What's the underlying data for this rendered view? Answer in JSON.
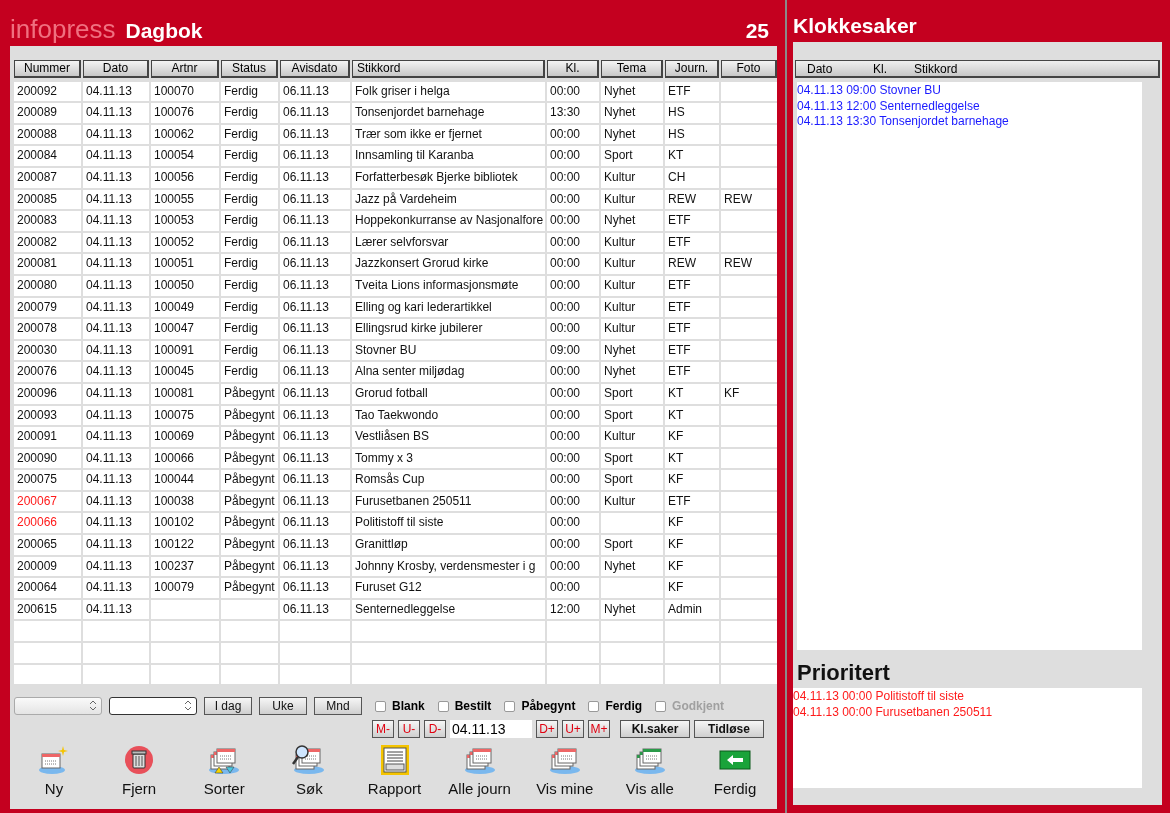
{
  "dagbok": {
    "brand": "infopress",
    "title": "Dagbok",
    "count": "25",
    "columns": [
      "Nummer",
      "Dato",
      "Artnr",
      "Status",
      "Avisdato",
      "Stikkord",
      "Kl.",
      "Tema",
      "Journ.",
      "Foto"
    ],
    "rows": [
      {
        "cells": [
          "200092",
          "04.11.13",
          "100070",
          "Ferdig",
          "06.11.13",
          "Folk griser i helga",
          "00:00",
          "Nyhet",
          "ETF",
          ""
        ],
        "flagged": false
      },
      {
        "cells": [
          "200089",
          "04.11.13",
          "100076",
          "Ferdig",
          "06.11.13",
          "Tonsenjordet barnehage",
          "13:30",
          "Nyhet",
          "HS",
          ""
        ],
        "flagged": false
      },
      {
        "cells": [
          "200088",
          "04.11.13",
          "100062",
          "Ferdig",
          "06.11.13",
          "Trær som ikke er fjernet",
          "00:00",
          "Nyhet",
          "HS",
          ""
        ],
        "flagged": false
      },
      {
        "cells": [
          "200084",
          "04.11.13",
          "100054",
          "Ferdig",
          "06.11.13",
          "Innsamling til Karanba",
          "00:00",
          "Sport",
          "KT",
          ""
        ],
        "flagged": false
      },
      {
        "cells": [
          "200087",
          "04.11.13",
          "100056",
          "Ferdig",
          "06.11.13",
          "Forfatterbesøk Bjerke bibliotek",
          "00:00",
          "Kultur",
          "CH",
          ""
        ],
        "flagged": false
      },
      {
        "cells": [
          "200085",
          "04.11.13",
          "100055",
          "Ferdig",
          "06.11.13",
          "Jazz på Vardeheim",
          "00:00",
          "Kultur",
          "REW",
          "REW"
        ],
        "flagged": false
      },
      {
        "cells": [
          "200083",
          "04.11.13",
          "100053",
          "Ferdig",
          "06.11.13",
          "Hoppekonkurranse av Nasjonalfore",
          "00:00",
          "Nyhet",
          "ETF",
          ""
        ],
        "flagged": false
      },
      {
        "cells": [
          "200082",
          "04.11.13",
          "100052",
          "Ferdig",
          "06.11.13",
          "Lærer selvforsvar",
          "00:00",
          "Kultur",
          "ETF",
          ""
        ],
        "flagged": false
      },
      {
        "cells": [
          "200081",
          "04.11.13",
          "100051",
          "Ferdig",
          "06.11.13",
          "Jazzkonsert Grorud kirke",
          "00:00",
          "Kultur",
          "REW",
          "REW"
        ],
        "flagged": false
      },
      {
        "cells": [
          "200080",
          "04.11.13",
          "100050",
          "Ferdig",
          "06.11.13",
          "Tveita Lions informasjonsmøte",
          "00:00",
          "Kultur",
          "ETF",
          ""
        ],
        "flagged": false
      },
      {
        "cells": [
          "200079",
          "04.11.13",
          "100049",
          "Ferdig",
          "06.11.13",
          "Elling og kari lederartikkel",
          "00:00",
          "Kultur",
          "ETF",
          ""
        ],
        "flagged": false
      },
      {
        "cells": [
          "200078",
          "04.11.13",
          "100047",
          "Ferdig",
          "06.11.13",
          "Ellingsrud kirke jubilerer",
          "00:00",
          "Kultur",
          "ETF",
          ""
        ],
        "flagged": false
      },
      {
        "cells": [
          "200030",
          "04.11.13",
          "100091",
          "Ferdig",
          "06.11.13",
          "Stovner BU",
          "09:00",
          "Nyhet",
          "ETF",
          ""
        ],
        "flagged": false
      },
      {
        "cells": [
          "200076",
          "04.11.13",
          "100045",
          "Ferdig",
          "06.11.13",
          "Alna senter miljødag",
          "00:00",
          "Nyhet",
          "ETF",
          ""
        ],
        "flagged": false
      },
      {
        "cells": [
          "200096",
          "04.11.13",
          "100081",
          "Påbegynt",
          "06.11.13",
          "Grorud fotball",
          "00:00",
          "Sport",
          "KT",
          "KF"
        ],
        "flagged": false
      },
      {
        "cells": [
          "200093",
          "04.11.13",
          "100075",
          "Påbegynt",
          "06.11.13",
          "Tao Taekwondo",
          "00:00",
          "Sport",
          "KT",
          ""
        ],
        "flagged": false
      },
      {
        "cells": [
          "200091",
          "04.11.13",
          "100069",
          "Påbegynt",
          "06.11.13",
          "Vestliåsen BS",
          "00:00",
          "Kultur",
          "KF",
          ""
        ],
        "flagged": false
      },
      {
        "cells": [
          "200090",
          "04.11.13",
          "100066",
          "Påbegynt",
          "06.11.13",
          "Tommy x 3",
          "00:00",
          "Sport",
          "KT",
          ""
        ],
        "flagged": false
      },
      {
        "cells": [
          "200075",
          "04.11.13",
          "100044",
          "Påbegynt",
          "06.11.13",
          "Romsås Cup",
          "00:00",
          "Sport",
          "KF",
          ""
        ],
        "flagged": false
      },
      {
        "cells": [
          "200067",
          "04.11.13",
          "100038",
          "Påbegynt",
          "06.11.13",
          "Furusetbanen 250511",
          "00:00",
          "Kultur",
          "ETF",
          ""
        ],
        "flagged": true
      },
      {
        "cells": [
          "200066",
          "04.11.13",
          "100102",
          "Påbegynt",
          "06.11.13",
          "Politistoff til siste",
          "00:00",
          "",
          "KF",
          ""
        ],
        "flagged": true
      },
      {
        "cells": [
          "200065",
          "04.11.13",
          "100122",
          "Påbegynt",
          "06.11.13",
          "Granittløp",
          "00:00",
          "Sport",
          "KF",
          ""
        ],
        "flagged": false
      },
      {
        "cells": [
          "200009",
          "04.11.13",
          "100237",
          "Påbegynt",
          "06.11.13",
          "Johnny Krosby, verdensmester i g",
          "00:00",
          "Nyhet",
          "KF",
          ""
        ],
        "flagged": false
      },
      {
        "cells": [
          "200064",
          "04.11.13",
          "100079",
          "Påbegynt",
          "06.11.13",
          "Furuset G12",
          "00:00",
          "",
          "KF",
          ""
        ],
        "flagged": false
      },
      {
        "cells": [
          "200615",
          "04.11.13",
          "",
          "",
          "06.11.13",
          "Senternedleggelse",
          "12:00",
          "Nyhet",
          "Admin",
          ""
        ],
        "flagged": false
      }
    ],
    "period_buttons": [
      "I dag",
      "Uke",
      "Mnd"
    ],
    "checkboxes": [
      {
        "label": "Blank",
        "checked": false,
        "disabled": false
      },
      {
        "label": "Bestilt",
        "checked": false,
        "disabled": false
      },
      {
        "label": "Påbegynt",
        "checked": false,
        "disabled": false
      },
      {
        "label": "Ferdig",
        "checked": false,
        "disabled": false
      },
      {
        "label": "Godkjent",
        "checked": false,
        "disabled": true
      }
    ],
    "back_buttons": [
      "M-",
      "U-",
      "D-"
    ],
    "date": "04.11.13",
    "forward_buttons": [
      "D+",
      "U+",
      "M+"
    ],
    "view_buttons": [
      "Kl.saker",
      "Tidløse"
    ],
    "toolbar": [
      {
        "label": "Ny",
        "kind": "new"
      },
      {
        "label": "Fjern",
        "kind": "delete"
      },
      {
        "label": "Sorter",
        "kind": "sort"
      },
      {
        "label": "Søk",
        "kind": "search"
      },
      {
        "label": "Rapport",
        "kind": "report"
      },
      {
        "label": "Alle journ",
        "kind": "stack"
      },
      {
        "label": "Vis mine",
        "kind": "stack"
      },
      {
        "label": "Vis alle",
        "kind": "stack-green"
      },
      {
        "label": "Ferdig",
        "kind": "exit"
      }
    ]
  },
  "klokkesaker": {
    "title": "Klokkesaker",
    "columns": [
      "Dato",
      "Kl.",
      "Stikkord"
    ],
    "items": [
      "04.11.13 09:00 Stovner BU",
      "04.11.13 12:00 Senternedleggelse",
      "04.11.13 13:30 Tonsenjordet barnehage"
    ],
    "prioritert_title": "Prioritert",
    "prioritert_items": [
      "04.11.13 00:00 Politistoff til siste",
      "04.11.13 00:00 Furusetbanen 250511"
    ]
  }
}
